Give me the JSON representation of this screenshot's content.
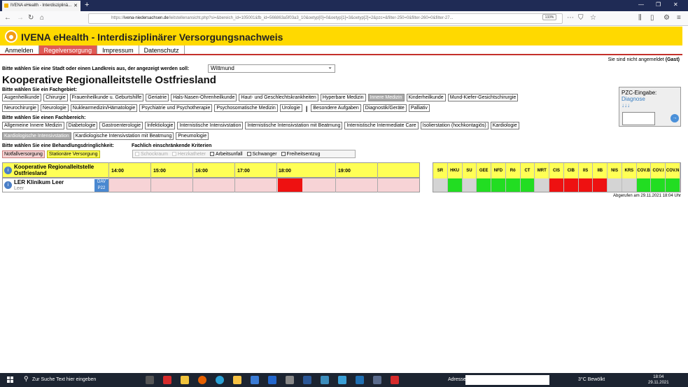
{
  "browser": {
    "tab_title": "IVENA eHealth - Interdisziplinä...",
    "url_prefix": "https://",
    "url_host": "ivena-niedersachsen.de",
    "url_rest": "/leitstellenansicht.php?si=&bereich_id=105001&fb_id=566863a5f03a3_10&oetyp[0]=0&oetyp[1]=3&oetyp[2]=2&pzc=&filter-250=0&filter-260=0&filter-27...",
    "zoom": "133%"
  },
  "header": {
    "title": "IVENA eHealth - Interdisziplinärer Versorgungsnachweis"
  },
  "menu": [
    "Anmelden",
    "Regelversorgung",
    "Impressum",
    "Datenschutz"
  ],
  "login_status": {
    "text": "Sie sind nicht angemeldet",
    "user": "(Gast)"
  },
  "city_prompt": "Bitte wählen Sie eine Stadt oder einen Landkreis aus, der angezeigt werden soll:",
  "city_value": "Wittmund",
  "main_title": "Kooperative Regionalleitstelle Ostfriesland",
  "fachgebiet_label": "Bitte wählen Sie ein Fachgebiet:",
  "fachgebiet_row1": [
    "Augenheilkunde",
    "Chirurgie",
    "Frauenheilkunde u. Geburtshilfe",
    "Geriatrie",
    "Hals-Nasen-Ohrenheilkunde",
    "Haut- und Geschlechtskrankheiten",
    "Hyperbare Medizin",
    "Innere Medizin",
    "Kinderheilkunde",
    "Mund-Kiefer-Gesichtschirurgie"
  ],
  "fachgebiet_row2": [
    "Neurochirurgie",
    "Neurologie",
    "Nuklearmedizin/Hämatologie",
    "Psychiatrie und Psychotherapie",
    "Psychosomatische Medizin",
    "Urologie"
  ],
  "fachgebiet_row2_sep": "|",
  "fachgebiet_row2_extra": [
    "Besondere Aufgaben",
    "Diagnostik/Geräte",
    "Palliativ"
  ],
  "fachbereich_label": "Bitte wählen Sie einen Fachbereich:",
  "fachbereich_row1": [
    "Allgemeine Innere Medizin",
    "Diabetologie",
    "Gastroenterologie",
    "Infektiologie",
    "Internistische Intensivstation",
    "Internistische Intensivstation mit Beatmung",
    "Internistische Intermediate Care",
    "Isolierstation (hochkontagiös)",
    "Kardiologie"
  ],
  "fachbereich_row2": [
    "Kardiologische Intensivstation",
    "Kardiologische Intensivstation mit Beatmung",
    "Pneumologie"
  ],
  "dringlichkeit_label": "Bitte wählen Sie eine Behandlungsdringlichkeit:",
  "kriterien_label": "Fachlich einschränkende Kriterien",
  "dringlichkeit": [
    "Notfallversorgung",
    "Stationäre Versorgung"
  ],
  "kriterien": [
    "Schockraum",
    "Herzkatheter",
    "Arbeitsunfall",
    "Schwanger",
    "Freiheitsentzug"
  ],
  "pzc": {
    "title": "PZC-Eingabe:",
    "link": "Diagnose",
    "arrows": "↓↓↓",
    "go": "→"
  },
  "timeline": {
    "leitstelle": "Kooperative Regionalleitstelle Ostfriesland",
    "times": [
      "14:00",
      "15:00",
      "16:00",
      "17:00",
      "18:00",
      "19:00"
    ],
    "hospital": "LER Klinikum Leer",
    "city": "Leer",
    "tags": [
      "DAV",
      "P22"
    ],
    "info_icon": "i"
  },
  "status_columns": [
    "SR",
    "HKU",
    "SU",
    "GEE",
    "NFD",
    "Rö",
    "CT",
    "MRT",
    "CIS",
    "CIB",
    "IIS",
    "IIB",
    "NIS",
    "KRS",
    "COV.B",
    "COV.I",
    "COV.N"
  ],
  "status_values": [
    "gray",
    "green",
    "gray",
    "green",
    "green",
    "green",
    "green",
    "gray",
    "red",
    "red",
    "red",
    "red",
    "gray",
    "gray",
    "green",
    "green",
    "green"
  ],
  "colors": {
    "green": "#22dd22",
    "red": "#ee1111",
    "gray": "#d4d4d4",
    "header_yellow": "#ffd900"
  },
  "fetched": "Abgerufen am 29.11.2021 18:04 Uhr",
  "taskbar": {
    "search": "Zur Suche Text hier eingeben",
    "address_label": "Adresse",
    "weather": "3°C  Bewölkt",
    "time": "18:04",
    "date": "29.11.2021"
  }
}
